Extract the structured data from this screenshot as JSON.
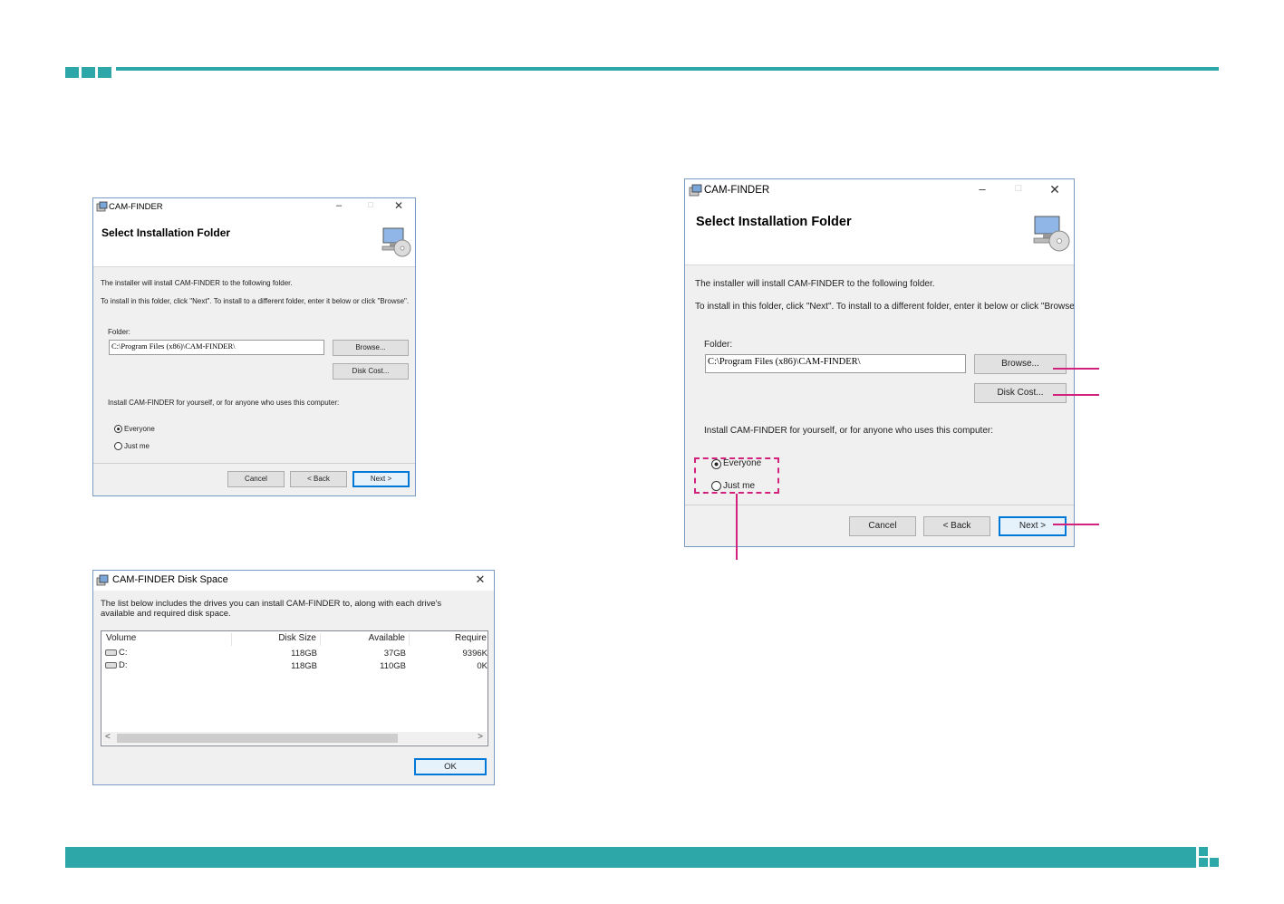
{
  "colors": {
    "accent": "#2ea7a8",
    "callout": "#d3227e",
    "focus": "#0078d7"
  },
  "installer": {
    "window_title": "CAM-FINDER",
    "heading": "Select Installation Folder",
    "line1": "The installer will install CAM-FINDER to the following folder.",
    "line2": "To install in this folder, click \"Next\". To install to a different folder, enter it below or click \"Browse\".",
    "folder_label": "Folder:",
    "folder_value": "C:\\Program Files (x86)\\CAM-FINDER\\",
    "browse": "Browse...",
    "disk_cost": "Disk Cost...",
    "install_for": "Install CAM-FINDER for yourself, or for anyone who uses this computer:",
    "everyone": "Everyone",
    "just_me": "Just me",
    "cancel": "Cancel",
    "back": "< Back",
    "next": "Next >",
    "minimize_icon": "minimize-icon",
    "maximize_icon": "maximize-icon",
    "close_icon": "close-icon"
  },
  "disk_space": {
    "window_title": "CAM-FINDER Disk Space",
    "description": "The list below includes the drives you can install CAM-FINDER to, along with each drive's available and required disk space.",
    "columns": [
      "Volume",
      "Disk Size",
      "Available",
      "Require"
    ],
    "rows": [
      [
        "C:",
        "118GB",
        "37GB",
        "9396K"
      ],
      [
        "D:",
        "118GB",
        "110GB",
        "0K"
      ]
    ],
    "ok": "OK",
    "scroll_left": "<",
    "scroll_right": ">"
  }
}
